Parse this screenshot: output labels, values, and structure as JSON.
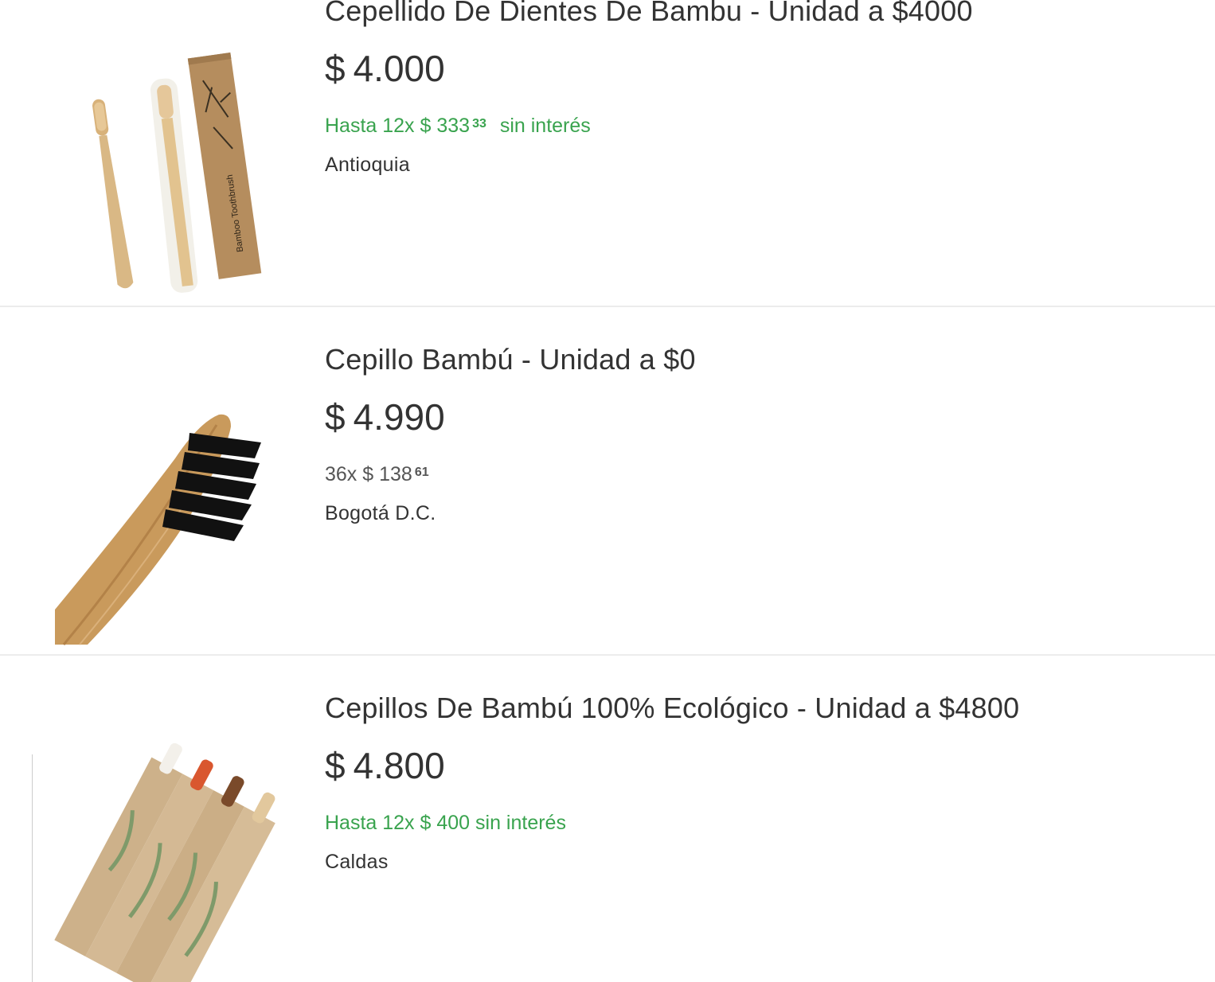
{
  "results": [
    {
      "title": "Cepellido De Dientes De Bambu - Unidad a $4000",
      "price_symbol": "$",
      "price": "4.000",
      "installments_prefix": "Hasta 12x",
      "installment_symbol": "$",
      "installment_amount": "333",
      "installment_cents": "33",
      "installments_suffix": "sin interés",
      "location": "Antioquia",
      "image": "bamboo-toothbrush-with-box-image"
    },
    {
      "title": "Cepillo Bambú - Unidad a $0",
      "price_symbol": "$",
      "price": "4.990",
      "installments_prefix": "36x",
      "installment_symbol": "$",
      "installment_amount": "138",
      "installment_cents": "61",
      "location": "Bogotá D.C.",
      "image": "bamboo-toothbrush-black-bristles-image"
    },
    {
      "title": "Cepillos De Bambú 100% Ecológico - Unidad a $4800",
      "price_symbol": "$",
      "price": "4.800",
      "installments_text": "Hasta 12x $ 400 sin interés",
      "location": "Caldas",
      "image": "bamboo-toothbrush-pack-image"
    }
  ],
  "colors": {
    "installments_green": "#39a34e",
    "text": "#333333",
    "divider": "#ececec"
  }
}
